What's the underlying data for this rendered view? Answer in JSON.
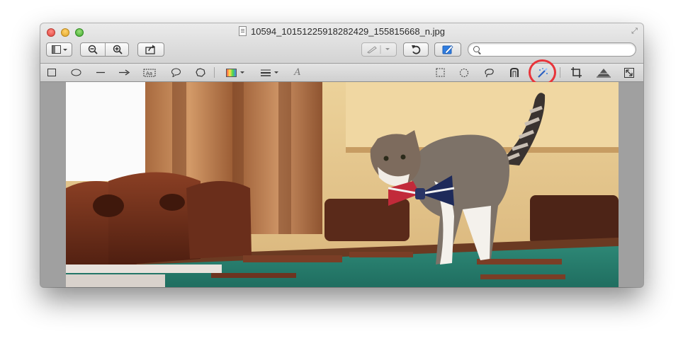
{
  "window": {
    "title": "10594_10151225918282429_155815668_n.jpg"
  },
  "toolbar": {
    "sidebar_button": "sidebar-view-icon",
    "zoom_out": "zoom-out-icon",
    "zoom_in": "zoom-in-icon",
    "share": "share-icon",
    "rotate": "rotate-left-icon",
    "edit": "edit-toolbar-icon",
    "search": {
      "value": "",
      "placeholder": ""
    }
  },
  "edit_tools": [
    "rectangle-shape-icon",
    "oval-shape-icon",
    "line-shape-icon",
    "arrow-shape-icon",
    "text-box-icon",
    "speech-bubble-icon",
    "outline-shape-icon",
    "color-picker-icon",
    "line-style-icon",
    "text-style-icon",
    "rectangular-selection-icon",
    "elliptical-selection-icon",
    "lasso-selection-icon",
    "smart-lasso-icon",
    "instant-alpha-icon",
    "crop-icon",
    "adjust-color-icon",
    "adjust-size-icon"
  ],
  "annotation": {
    "highlighted_tool": "instant-alpha-icon",
    "ring_color": "#e8343a"
  },
  "colors": {
    "window_gray": "#d3d3d3",
    "accent_blue": "#2f7de1",
    "canvas_gray": "#a0a0a0"
  }
}
